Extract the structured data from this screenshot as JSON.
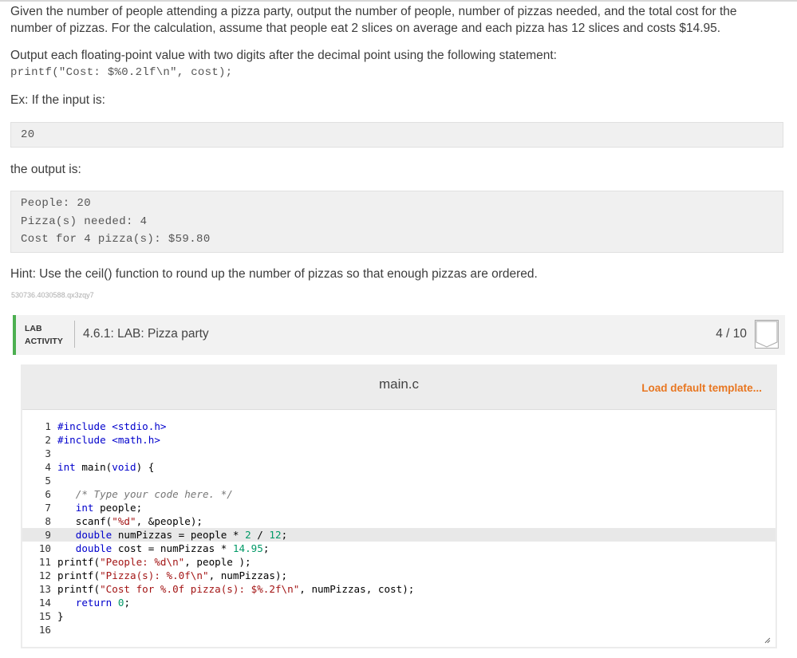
{
  "description": {
    "para1": "Given the number of people attending a pizza party, output the number of people, number of pizzas needed, and the total cost for the number of pizzas. For the calculation, assume that people eat 2 slices on average and each pizza has 12 slices and costs $14.95.",
    "para2": "Output each floating-point value with two digits after the decimal point using the following statement:",
    "printf_code": "printf(\"Cost: $%0.2lf\\n\", cost);",
    "example_intro": "Ex: If the input is:",
    "input_value": "20",
    "output_intro": "the output is:",
    "output_lines": [
      "People: 20",
      "Pizza(s) needed: 4",
      "Cost for 4 pizza(s): $59.80"
    ],
    "hint": "Hint: Use the ceil() function to round up the number of pizzas so that enough pizzas are ordered.",
    "stamp": "530736.4030588.qx3zqy7"
  },
  "lab": {
    "tag_line1": "LAB",
    "tag_line2": "ACTIVITY",
    "title": "4.6.1: LAB: Pizza party",
    "score": "4 / 10"
  },
  "editor": {
    "file_name": "main.c",
    "load_default_label": "Load default template...",
    "highlighted_line": 9,
    "lines": [
      "#include <stdio.h>",
      "#include <math.h>",
      "",
      "int main(void) {",
      "",
      "   /* Type your code here. */",
      "   int people;",
      "   scanf(\"%d\", &people);",
      "   double numPizzas = people * 2 / 12;",
      "   double cost = numPizzas * 14.95;",
      "printf(\"People: %d\\n\", people );",
      "printf(\"Pizza(s): %.0f\\n\", numPizzas);",
      "printf(\"Cost for %.0f pizza(s): $%.2f\\n\", numPizzas, cost);",
      "   return 0;",
      "}",
      ""
    ]
  },
  "colors": {
    "accent_green": "#4caf50",
    "link_orange": "#e87722"
  }
}
